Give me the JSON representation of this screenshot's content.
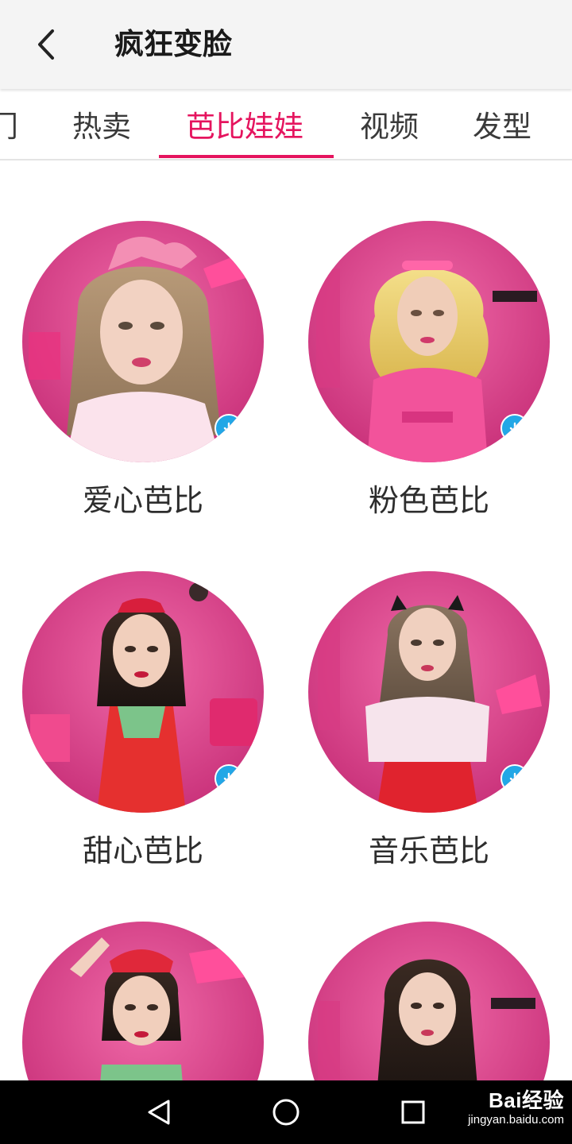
{
  "header": {
    "title": "疯狂变脸",
    "back_icon": "chevron-left-icon"
  },
  "tabs": [
    {
      "label": "门",
      "active": false
    },
    {
      "label": "热卖",
      "active": false
    },
    {
      "label": "芭比娃娃",
      "active": true
    },
    {
      "label": "视频",
      "active": false
    },
    {
      "label": "发型",
      "active": false
    }
  ],
  "colors": {
    "accent": "#e5145e",
    "badge": "#22a7e6",
    "card_bg": "#e0428a"
  },
  "items": [
    {
      "label": "爱心芭比",
      "download_icon": "arrow-down-icon"
    },
    {
      "label": "粉色芭比",
      "download_icon": "arrow-down-icon"
    },
    {
      "label": "甜心芭比",
      "download_icon": "arrow-down-icon"
    },
    {
      "label": "音乐芭比",
      "download_icon": "arrow-down-icon"
    },
    {
      "label": "",
      "download_icon": ""
    },
    {
      "label": "",
      "download_icon": ""
    }
  ],
  "navbar": {
    "back": "triangle-back-icon",
    "home": "circle-home-icon",
    "recents": "square-recents-icon"
  },
  "watermark": {
    "brand": "Bai经验",
    "url": "jingyan.baidu.com"
  }
}
